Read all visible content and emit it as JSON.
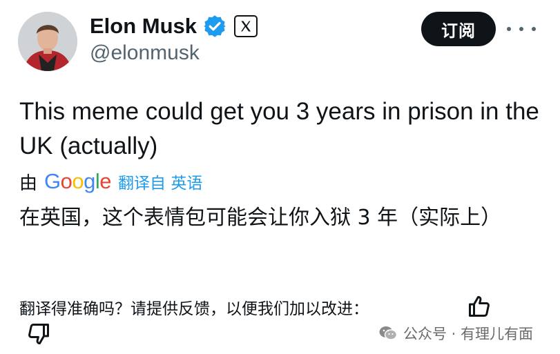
{
  "profile": {
    "name": "Elon Musk",
    "handle": "@elonmusk",
    "verified_icon": "verified-badge-icon",
    "affiliation_icon": "x-logo-icon"
  },
  "actions": {
    "subscribe_label": "订阅",
    "more_icon": "more-dots-icon"
  },
  "tweet": {
    "text": "This meme could get you 3 years in prison in the UK (actually)"
  },
  "translation": {
    "by_label": "由",
    "provider": "Google",
    "link_label": "翻译自 英语",
    "text": "在英国，这个表情包可能会让你入狱 3 年（实际上）"
  },
  "feedback": {
    "prompt": "翻译得准确吗？请提供反馈，以便我们加以改进：",
    "thumbs_up_icon": "thumbs-up-icon",
    "thumbs_down_icon": "thumbs-down-icon"
  },
  "watermark": {
    "text": "公众号 · 有理儿有面"
  },
  "colors": {
    "accent_blue": "#1d9bf0",
    "text_primary": "#0f1419",
    "text_secondary": "#536471",
    "button_dark": "#0f1419",
    "google_blue": "#4285F4",
    "google_red": "#EA4335",
    "google_yellow": "#FBBC05",
    "google_green": "#34A853"
  }
}
